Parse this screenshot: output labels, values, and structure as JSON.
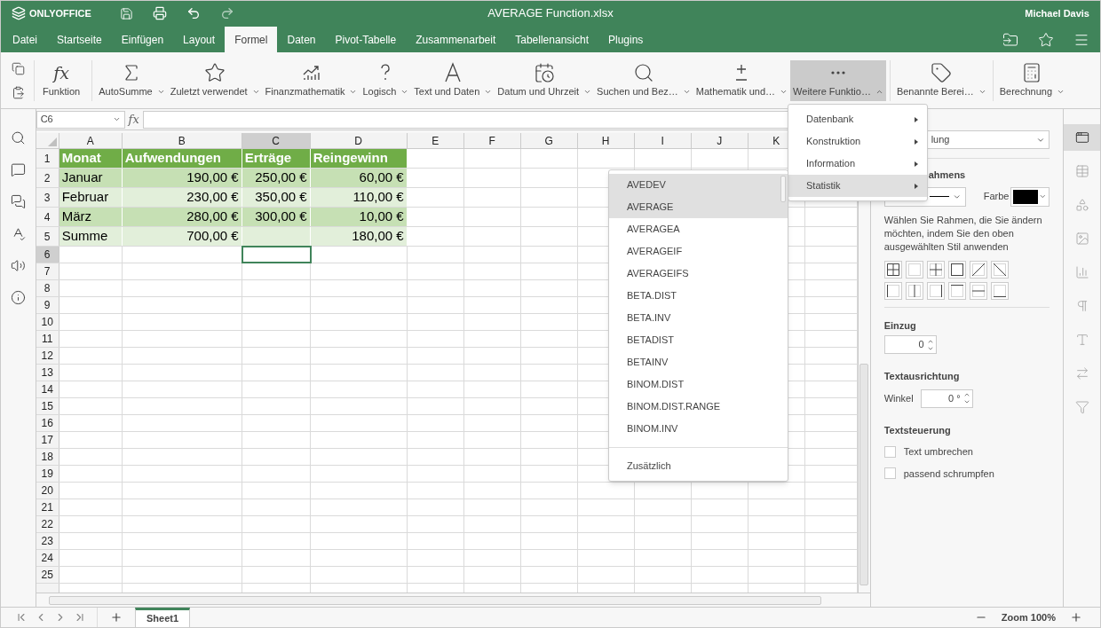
{
  "app": {
    "logo": "ONLYOFFICE",
    "title": "AVERAGE Function.xlsx",
    "user": "Michael Davis"
  },
  "menu_tabs": [
    {
      "label": "Datei",
      "selected": false
    },
    {
      "label": "Startseite",
      "selected": false
    },
    {
      "label": "Einfügen",
      "selected": false
    },
    {
      "label": "Layout",
      "selected": false
    },
    {
      "label": "Formel",
      "selected": true
    },
    {
      "label": "Daten",
      "selected": false
    },
    {
      "label": "Pivot-Tabelle",
      "selected": false
    },
    {
      "label": "Zusammenarbeit",
      "selected": false
    },
    {
      "label": "Tabellenansicht",
      "selected": false
    },
    {
      "label": "Plugins",
      "selected": false
    }
  ],
  "toolbar": [
    {
      "label": "Funktion",
      "icon_text": "fx",
      "dropdown": false,
      "expanded": false
    },
    {
      "label": "AutoSumme",
      "dropdown": true,
      "expanded": false
    },
    {
      "label": "Zuletzt verwendet",
      "dropdown": true,
      "expanded": false
    },
    {
      "label": "Finanzmathematik",
      "dropdown": true,
      "expanded": false
    },
    {
      "label": "Logisch",
      "dropdown": true,
      "expanded": false
    },
    {
      "label": "Text und Daten",
      "dropdown": true,
      "expanded": false
    },
    {
      "label": "Datum und Uhrzeit",
      "dropdown": true,
      "expanded": false
    },
    {
      "label": "Suchen und Bez…",
      "dropdown": true,
      "expanded": false
    },
    {
      "label": "Mathematik und…",
      "dropdown": true,
      "expanded": false
    },
    {
      "label": "Weitere Funktio…",
      "dropdown": true,
      "expanded": true
    },
    {
      "label": "Benannte Berei…",
      "dropdown": true,
      "expanded": false
    },
    {
      "label": "Berechnung",
      "dropdown": true,
      "expanded": false
    }
  ],
  "formula_bar": {
    "cell_ref": "C6",
    "fx": "fx"
  },
  "sheet": {
    "columns": [
      {
        "label": "A",
        "selected": false
      },
      {
        "label": "B",
        "selected": false
      },
      {
        "label": "C",
        "selected": true
      },
      {
        "label": "D",
        "selected": false
      },
      {
        "label": "E",
        "selected": false
      },
      {
        "label": "F",
        "selected": false
      },
      {
        "label": "G",
        "selected": false
      },
      {
        "label": "H",
        "selected": false
      },
      {
        "label": "I",
        "selected": false
      },
      {
        "label": "J",
        "selected": false
      },
      {
        "label": "K",
        "selected": false
      }
    ],
    "rows": [
      {
        "header": "1",
        "selected": false,
        "kind": "header",
        "cells": [
          "Monat",
          "Aufwendungen",
          "Erträge",
          "Reingewinn"
        ]
      },
      {
        "header": "2",
        "selected": false,
        "kind": "data",
        "cells": [
          "Januar",
          "190,00 €",
          "250,00 €",
          "60,00 €"
        ]
      },
      {
        "header": "3",
        "selected": false,
        "kind": "data",
        "cells": [
          "Februar",
          "230,00 €",
          "350,00 €",
          "110,00 €"
        ]
      },
      {
        "header": "4",
        "selected": false,
        "kind": "data",
        "cells": [
          "März",
          "280,00 €",
          "300,00 €",
          "10,00 €"
        ]
      },
      {
        "header": "5",
        "selected": false,
        "kind": "data",
        "cells": [
          "Summe",
          "700,00 €",
          null,
          "180,00 €"
        ]
      },
      {
        "header": "6",
        "selected": true
      },
      {
        "header": "7",
        "selected": false
      },
      {
        "header": "8",
        "selected": false
      },
      {
        "header": "9",
        "selected": false
      },
      {
        "header": "10",
        "selected": false
      },
      {
        "header": "11",
        "selected": false
      },
      {
        "header": "12",
        "selected": false
      },
      {
        "header": "13",
        "selected": false
      },
      {
        "header": "14",
        "selected": false
      },
      {
        "header": "15",
        "selected": false
      },
      {
        "header": "16",
        "selected": false
      },
      {
        "header": "17",
        "selected": false
      },
      {
        "header": "18",
        "selected": false
      },
      {
        "header": "19",
        "selected": false
      },
      {
        "header": "20",
        "selected": false
      },
      {
        "header": "21",
        "selected": false
      },
      {
        "header": "22",
        "selected": false
      },
      {
        "header": "23",
        "selected": false
      },
      {
        "header": "24",
        "selected": false
      },
      {
        "header": "25",
        "selected": false
      }
    ]
  },
  "function_menu": [
    {
      "label": "Datenbank",
      "selected": false
    },
    {
      "label": "Konstruktion",
      "selected": false
    },
    {
      "label": "Information",
      "selected": false
    },
    {
      "label": "Statistik",
      "selected": true
    }
  ],
  "submenu": {
    "items": [
      {
        "label": "AVEDEV",
        "highlighted": true
      },
      {
        "label": "AVERAGE",
        "highlighted": true
      },
      {
        "label": "AVERAGEA",
        "highlighted": false
      },
      {
        "label": "AVERAGEIF",
        "highlighted": false
      },
      {
        "label": "AVERAGEIFS",
        "highlighted": false
      },
      {
        "label": "BETA.DIST",
        "highlighted": false
      },
      {
        "label": "BETA.INV",
        "highlighted": false
      },
      {
        "label": "BETADIST",
        "highlighted": false
      },
      {
        "label": "BETAINV",
        "highlighted": false
      },
      {
        "label": "BINOM.DIST",
        "highlighted": false
      },
      {
        "label": "BINOM.DIST.RANGE",
        "highlighted": false
      },
      {
        "label": "BINOM.INV",
        "highlighted": false
      }
    ],
    "footer": "Zusätzlich"
  },
  "right_panel": {
    "style_select": "lung",
    "border_heading": "ahmens",
    "color_label": "Farbe",
    "border_hint": "Wählen Sie Rahmen, die Sie ändern möchten, indem Sie den oben ausgewählten Stil anwenden",
    "indent_heading": "Einzug",
    "indent_value": "0",
    "orientation_heading": "Textausrichtung",
    "angle_label": "Winkel",
    "angle_value": "0 °",
    "control_heading": "Textsteuerung",
    "checkboxes": [
      {
        "label": "Text umbrechen",
        "checked": false
      },
      {
        "label": "passend schrumpfen",
        "checked": false
      }
    ]
  },
  "sheet_tabs": [
    {
      "label": "Sheet1",
      "selected": true
    }
  ],
  "zoom": "Zoom 100%"
}
